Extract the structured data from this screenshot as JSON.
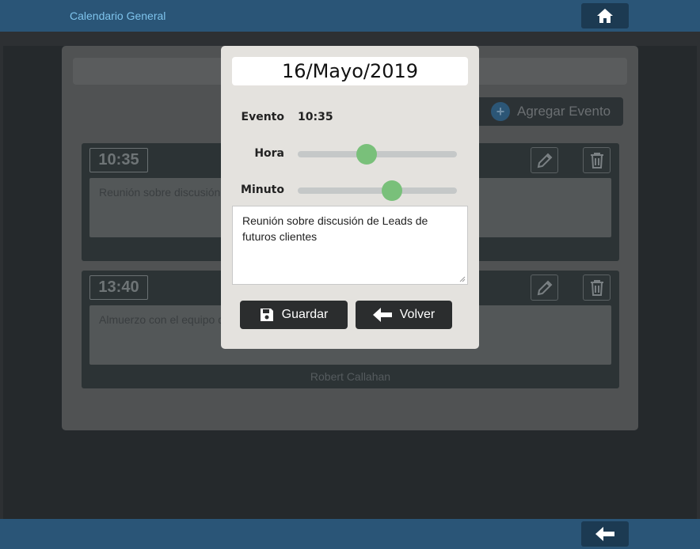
{
  "header": {
    "title": "Calendario General",
    "home_icon": "home-icon"
  },
  "footer": {
    "back_icon": "arrow-left-icon"
  },
  "toolbar": {
    "add_event_label": "Agregar Evento"
  },
  "events": [
    {
      "time": "10:35",
      "text": "Reunión sobre discusión d",
      "author": ""
    },
    {
      "time": "13:40",
      "text": "Almuerzo con el equipo d",
      "author": "Robert Callahan"
    }
  ],
  "modal": {
    "date": "16/Mayo/2019",
    "event_label": "Evento",
    "event_value": "10:35",
    "hour_label": "Hora",
    "hour_value": 10,
    "hour_max": 23,
    "minute_label": "Minuto",
    "minute_value": 35,
    "minute_max": 59,
    "description": "Reunión sobre discusión de Leads de futuros clientes",
    "save_label": "Guardar",
    "back_label": "Volver"
  },
  "colors": {
    "topbar": "#2a5577",
    "accent_text": "#7ec3ec",
    "slider_thumb": "#79c07a",
    "button_dark": "#2b2d2e"
  }
}
